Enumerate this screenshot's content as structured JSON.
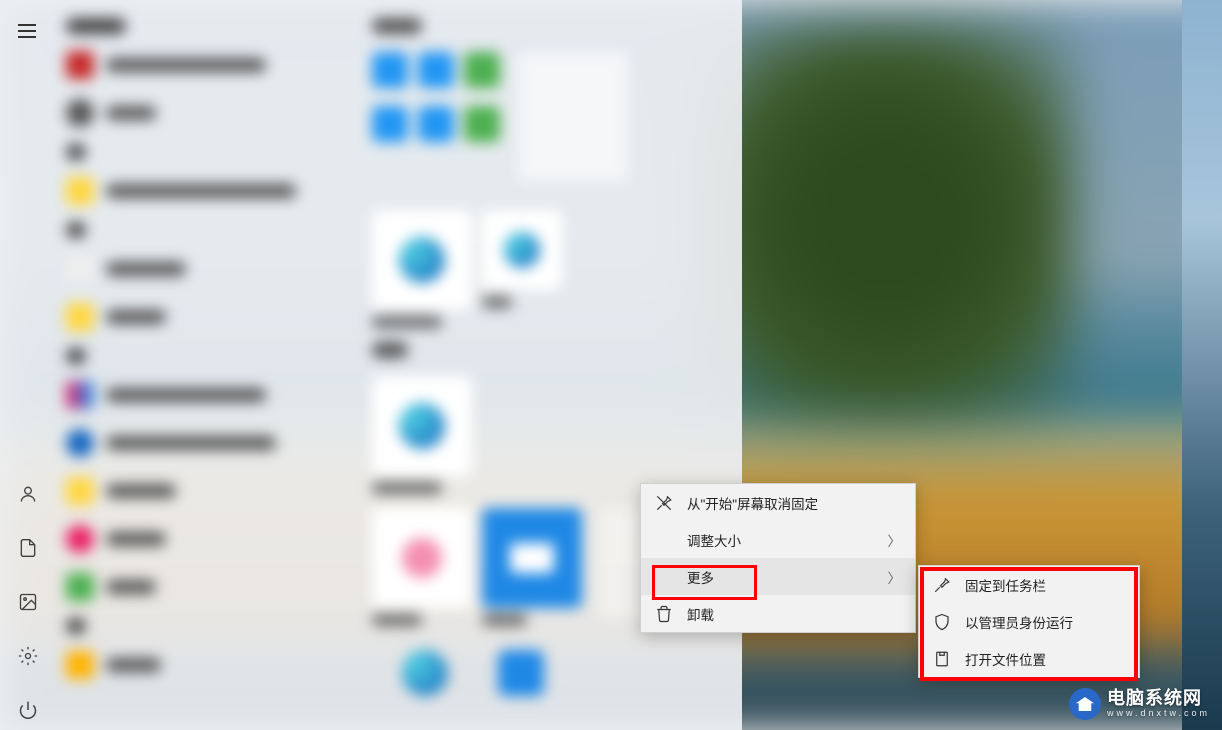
{
  "context_menu": {
    "items": [
      {
        "label": "从\"开始\"屏幕取消固定",
        "icon": "unpin-icon",
        "has_chevron": false
      },
      {
        "label": "调整大小",
        "icon": null,
        "has_chevron": true
      },
      {
        "label": "更多",
        "icon": null,
        "has_chevron": true,
        "highlighted": true
      },
      {
        "label": "卸载",
        "icon": "trash-icon",
        "has_chevron": false
      }
    ]
  },
  "submenu": {
    "items": [
      {
        "label": "固定到任务栏",
        "icon": "pin-icon"
      },
      {
        "label": "以管理员身份运行",
        "icon": "shield-icon"
      },
      {
        "label": "打开文件位置",
        "icon": "folder-icon"
      }
    ]
  },
  "watermark": {
    "title": "电脑系统网",
    "url": "www.dnxtw.com"
  },
  "rail_icons": [
    "user",
    "documents",
    "pictures",
    "settings",
    "power"
  ]
}
